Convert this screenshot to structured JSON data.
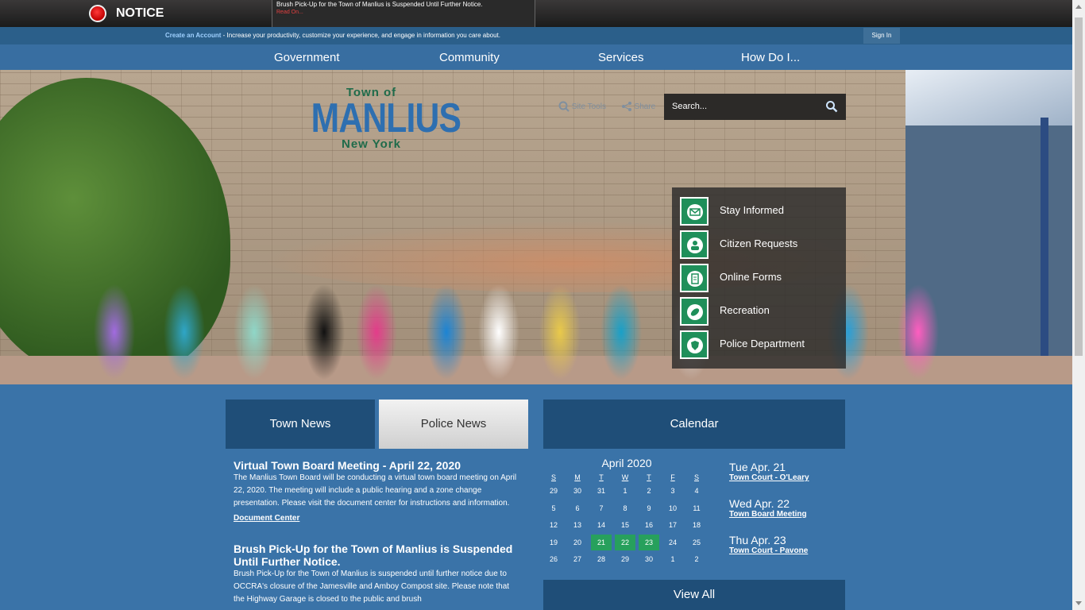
{
  "notice": {
    "label": "NOTICE",
    "message": "Brush Pick-Up for the Town of Manlius is Suspended Until Further Notice.",
    "read_on": "Read On..."
  },
  "account": {
    "create_link": "Create an Account",
    "text": " - Increase your productivity, customize your experience, and engage in information you care about.",
    "sign_in": "Sign In"
  },
  "nav": [
    "Government",
    "Community",
    "Services",
    "How Do I..."
  ],
  "logo": {
    "town_of": "Town of",
    "name": "MANLIUS",
    "state": "New York"
  },
  "tools": {
    "site_tools": "Site Tools",
    "share": "Share"
  },
  "search": {
    "placeholder": "Search..."
  },
  "quick_links": [
    "Stay Informed",
    "Citizen Requests",
    "Online Forms",
    "Recreation",
    "Police Department"
  ],
  "tabs": {
    "town_news": "Town News",
    "police_news": "Police News",
    "calendar": "Calendar"
  },
  "news": [
    {
      "title": "Virtual Town Board Meeting - April 22, 2020",
      "body": "The Manlius Town Board will be conducting a virtual town board meeting on April 22, 2020. The meeting will include a public hearing and a zone change presentation. Please visit the document center for instructions and information.",
      "link": "Document Center"
    },
    {
      "title": "Brush Pick-Up for the Town of Manlius is Suspended Until Further Notice.",
      "body": "Brush Pick-Up for the Town of Manlius is suspended until further notice due to OCCRA's closure of the Jamesville and Amboy Compost site. Please note that the Highway Garage is closed to the public and brush"
    }
  ],
  "calendar": {
    "month": "April 2020",
    "days_of_week": [
      "S",
      "M",
      "T",
      "W",
      "T",
      "F",
      "S"
    ],
    "weeks": [
      [
        "29",
        "30",
        "31",
        "1",
        "2",
        "3",
        "4"
      ],
      [
        "5",
        "6",
        "7",
        "8",
        "9",
        "10",
        "11"
      ],
      [
        "12",
        "13",
        "14",
        "15",
        "16",
        "17",
        "18"
      ],
      [
        "19",
        "20",
        "21",
        "22",
        "23",
        "24",
        "25"
      ],
      [
        "26",
        "27",
        "28",
        "29",
        "30",
        "1",
        "2"
      ]
    ],
    "highlighted": [
      "21",
      "22",
      "23"
    ],
    "events": [
      {
        "date": "Tue Apr. 21",
        "title": "Town Court - O'Leary"
      },
      {
        "date": "Wed Apr. 22",
        "title": "Town Board Meeting"
      },
      {
        "date": "Thu Apr. 23",
        "title": "Town Court - Pavone"
      }
    ],
    "view_all": "View All"
  }
}
